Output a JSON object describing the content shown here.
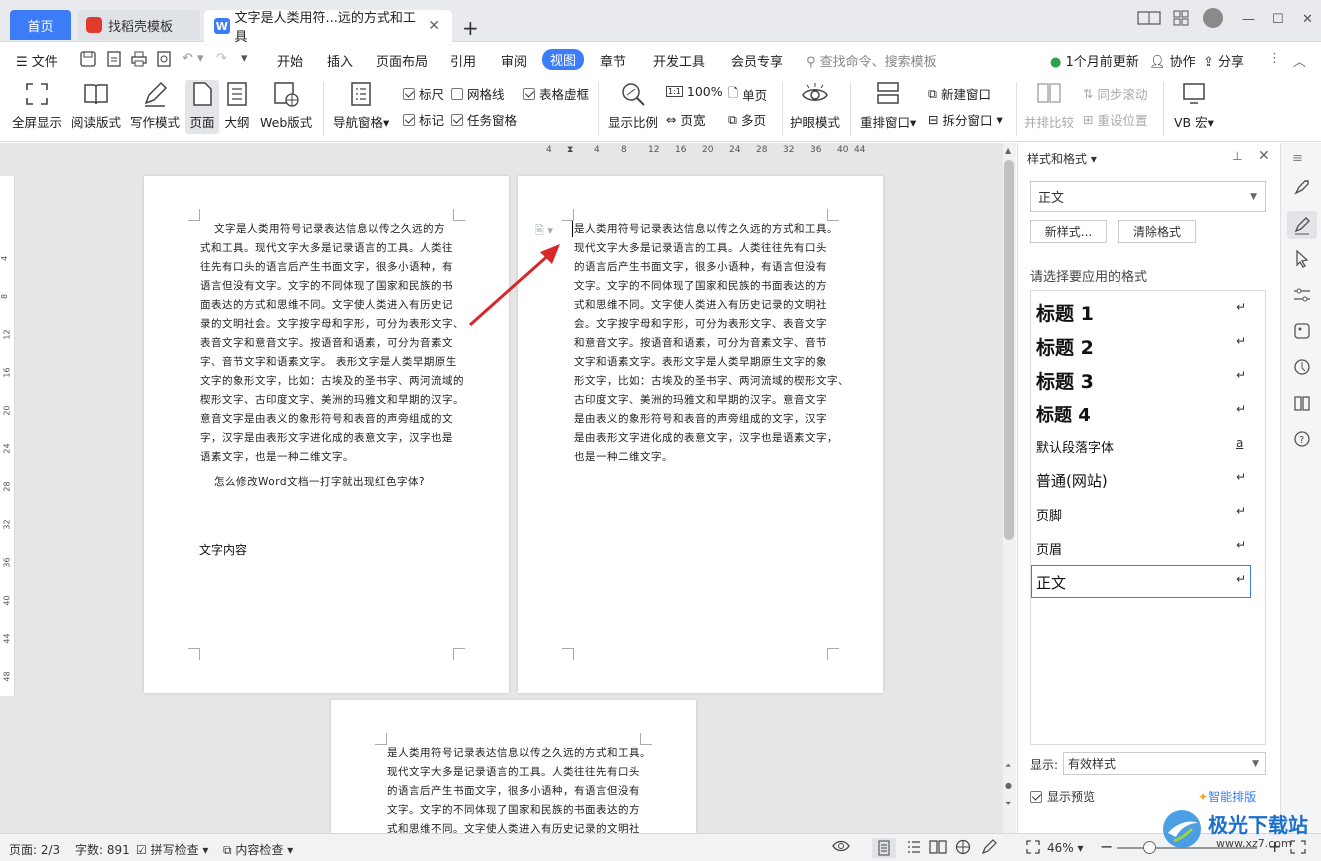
{
  "tabs": {
    "home": "首页",
    "template": "找稻壳模板",
    "doc": "文字是人类用符...远的方式和工具"
  },
  "menu": {
    "file": "文件",
    "items": [
      "开始",
      "插入",
      "页面布局",
      "引用",
      "审阅",
      "视图",
      "章节",
      "开发工具",
      "会员专享"
    ],
    "search_placeholder": "查找命令、搜索模板",
    "update": "1个月前更新",
    "collab": "协作",
    "share": "分享"
  },
  "ribbon": {
    "fullscreen": "全屏显示",
    "read": "阅读版式",
    "write": "写作模式",
    "page": "页面",
    "outline": "大纲",
    "web": "Web版式",
    "nav": "导航窗格",
    "ruler": "标尺",
    "grid": "网格线",
    "tablegrid": "表格虚框",
    "mark": "标记",
    "taskpane": "任务窗格",
    "zoom": "显示比例",
    "zoom100": "100%",
    "single": "单页",
    "pagewidth": "页宽",
    "multi": "多页",
    "eye": "护眼模式",
    "rearrange": "重排窗口",
    "newwin": "新建窗口",
    "split": "拆分窗口",
    "sidebyside": "并排比较",
    "syncscroll": "同步滚动",
    "resetpos": "重设位置",
    "vb": "VB 宏"
  },
  "ruler_ticks": [
    "4",
    "4",
    "8",
    "12",
    "16",
    "20",
    "24",
    "28",
    "32",
    "36",
    "40",
    "44"
  ],
  "vruler_ticks": [
    "4",
    "8",
    "12",
    "16",
    "20",
    "24",
    "28",
    "32",
    "36",
    "40",
    "44",
    "48"
  ],
  "page1": {
    "lines": [
      "文字是人类用符号记录表达信息以传之久远的方",
      "式和工具。现代文字大多是记录语言的工具。人类往",
      "往先有口头的语言后产生书面文字，很多小语种，有",
      "语言但没有文字。文字的不同体现了国家和民族的书",
      "面表达的方式和思维不同。文字使人类进入有历史记",
      "录的文明社会。文字按字母和字形，可分为表形文字、",
      "表音文字和意音文字。按语音和语素，可分为音素文",
      "字、音节文字和语素文字。 表形文字是人类早期原生",
      "文字的象形文字，比如：古埃及的圣书字、两河流域的",
      "楔形文字、古印度文字、美洲的玛雅文和早期的汉字。",
      "意音文字是由表义的象形符号和表音的声旁组成的文",
      "字，汉字是由表形文字进化成的表意文字，汉字也是",
      "语素文字，也是一种二维文字。"
    ],
    "question": "怎么修改Word文档一打字就出现红色字体?",
    "content": "文字内容"
  },
  "page2": {
    "lines": [
      "是人类用符号记录表达信息以传之久远的方式和工具。",
      "现代文字大多是记录语言的工具。人类往往先有口头",
      "的语言后产生书面文字，很多小语种，有语言但没有",
      "文字。文字的不同体现了国家和民族的书面表达的方",
      "式和思维不同。文字使人类进入有历史记录的文明社",
      "会。文字按字母和字形，可分为表形文字、表音文字",
      "和意音文字。按语音和语素，可分为音素文字、音节",
      "文字和语素文字。表形文字是人类早期原生文字的象",
      "形文字，比如：古埃及的圣书字、两河流域的楔形文字、",
      "古印度文字、美洲的玛雅文和早期的汉字。意音文字",
      "是由表义的象形符号和表音的声旁组成的文字，汉字",
      "是由表形文字进化成的表意文字，汉字也是语素文字，",
      "也是一种二维文字。"
    ]
  },
  "page3": {
    "lines": [
      "是人类用符号记录表达信息以传之久远的方式和工具。",
      "现代文字大多是记录语言的工具。人类往往先有口头",
      "的语言后产生书面文字，很多小语种，有语言但没有",
      "文字。文字的不同体现了国家和民族的书面表达的方",
      "式和思维不同。文字使人类进入有历史记录的文明社"
    ]
  },
  "panel": {
    "title": "样式和格式",
    "current_style": "正文",
    "new_style": "新样式...",
    "clear_format": "清除格式",
    "prompt": "请选择要应用的格式",
    "styles": [
      "标题 1",
      "标题 2",
      "标题 3",
      "标题 4",
      "默认段落字体",
      "普通(网站)",
      "页脚",
      "页眉",
      "正文"
    ],
    "show_label": "显示:",
    "show_value": "有效样式",
    "preview": "显示预览",
    "smart": "智能排版"
  },
  "status": {
    "page": "页面: 2/3",
    "words": "字数: 891",
    "spell": "拼写检查",
    "content_check": "内容检查",
    "zoom": "46%"
  },
  "watermark": "极光下载站",
  "watermark_url": "www.xz7.com",
  "colors": {
    "accent": "#3c7cf7",
    "arrow": "#d9262b",
    "workspace": "#e6e6e6"
  }
}
